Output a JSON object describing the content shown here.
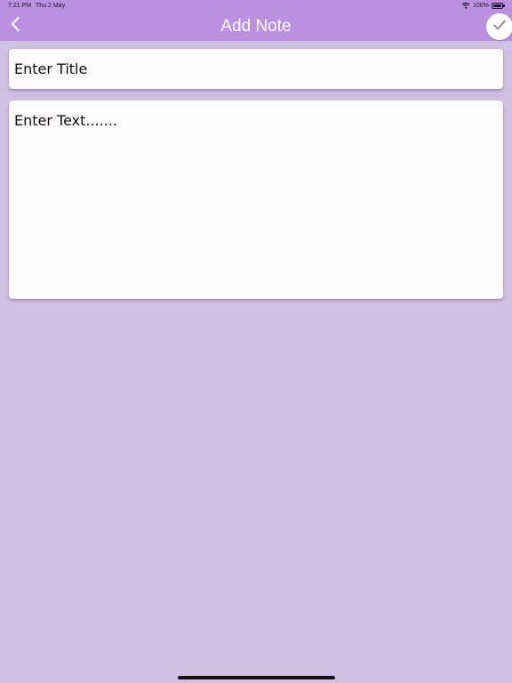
{
  "status_bar": {
    "time": "7:21 PM",
    "date": "Thu 2 May",
    "battery": "100%"
  },
  "header": {
    "title": "Add Note",
    "back_icon": "chevron-left-icon",
    "save_icon": "checkmark-icon"
  },
  "form": {
    "title_placeholder": "Enter Title",
    "title_value": "",
    "text_placeholder": "Enter Text.......",
    "text_value": ""
  },
  "colors": {
    "nav_background": "#bb90e0",
    "page_background": "#d0c1e3",
    "card_background": "#fefbfd"
  }
}
